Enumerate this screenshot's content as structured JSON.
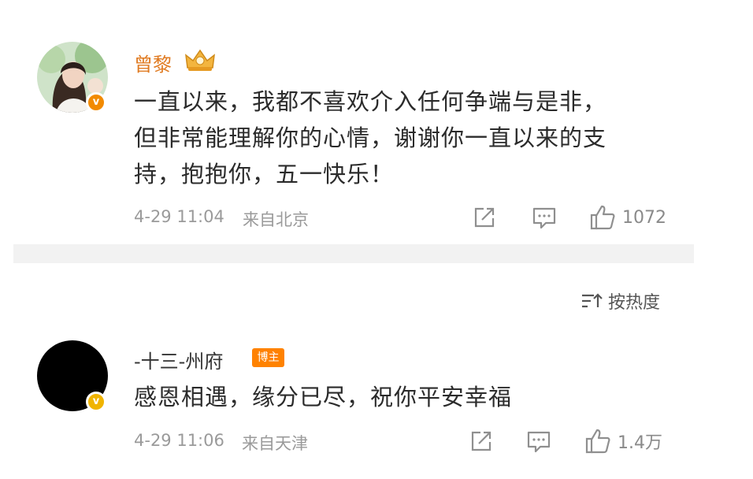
{
  "post": {
    "username": "曾黎",
    "text_lines": [
      "一直以来，我都不喜欢介入任何争端与是非，",
      "但非常能理解你的心情，谢谢你一直以来的支",
      "持，抱抱你，五一快乐！"
    ],
    "timestamp": "4-29 11:04",
    "source": "来自北京",
    "like_count": "1072",
    "badge_icon": "crown-vip-icon",
    "verify_color": "#f28a00",
    "username_color": "#e07b22"
  },
  "sort": {
    "label": "按热度"
  },
  "comment": {
    "username": "-十三-州府",
    "tag": "博主",
    "text": "感恩相遇，缘分已尽，祝你平安幸福",
    "timestamp": "4-29 11:06",
    "source": "来自天津",
    "like_count": "1.4万",
    "username_color": "#333333",
    "verify_color": "#f0b400"
  }
}
